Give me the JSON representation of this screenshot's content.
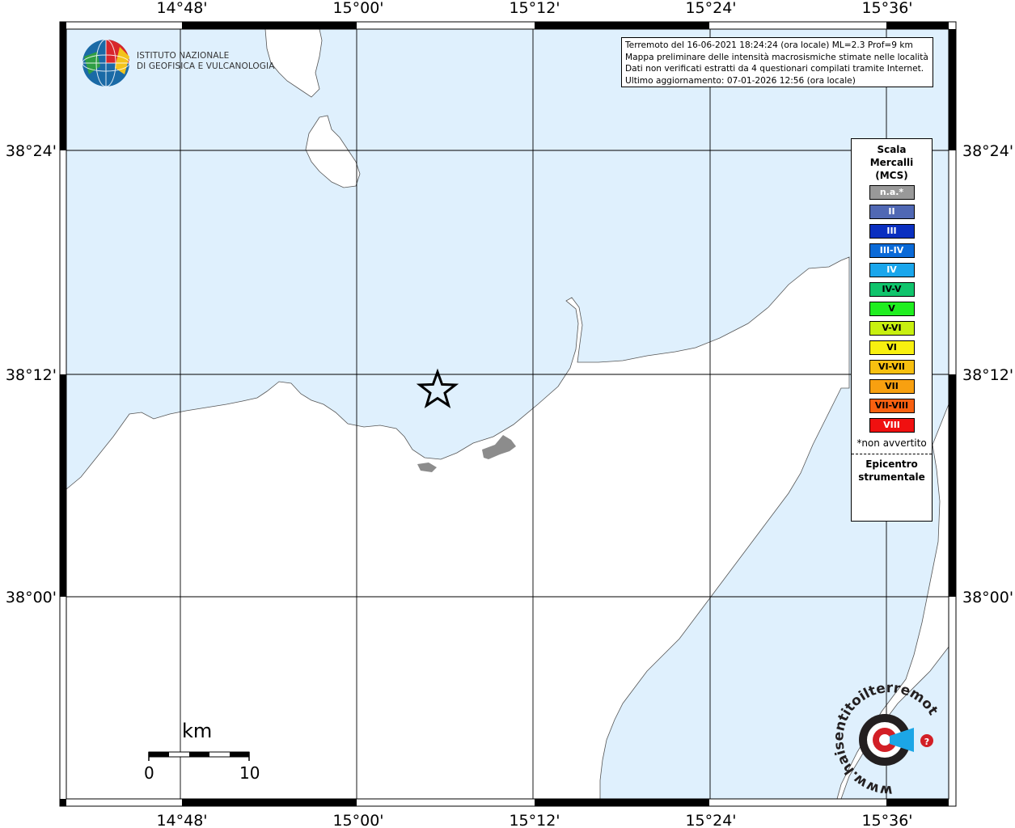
{
  "map": {
    "lon_ticks_top": [
      "14°48'",
      "15°00'",
      "15°12'",
      "15°24'",
      "15°36'"
    ],
    "lon_ticks_bottom": [
      "14°48'",
      "15°00'",
      "15°12'",
      "15°24'",
      "15°36'"
    ],
    "lat_ticks_left": [
      "38°24'",
      "38°12'",
      "38°00'"
    ],
    "lat_ticks_right": [
      "38°24'",
      "38°12'",
      "38°00'"
    ],
    "colors": {
      "sea": "#dff0fd",
      "land": "#ffffff",
      "town": "#8c8c8c"
    }
  },
  "info": {
    "line1": "Terremoto del 16-06-2021 18:24:24 (ora locale) ML=2.3 Prof=9 km",
    "line2": "Mappa preliminare delle intensità macrosismiche stimate nelle località",
    "line3": "Dati non verificati estratti da 4 questionari compilati tramite Internet.",
    "line4": "Ultimo aggiornamento: 07-01-2026 12:56 (ora locale)"
  },
  "logo": {
    "line1": "ISTITUTO NAZIONALE",
    "line2": "DI GEOFISICA E VULCANOLOGIA"
  },
  "legend": {
    "title1": "Scala",
    "title2": "Mercalli",
    "title3": "(MCS)",
    "classes": [
      {
        "label": "n.a.*",
        "color": "#999999"
      },
      {
        "label": "II",
        "color": "#5068b4"
      },
      {
        "label": "III",
        "color": "#0a2fc0"
      },
      {
        "label": "III-IV",
        "color": "#0a6ad8"
      },
      {
        "label": "IV",
        "color": "#1aa6ec"
      },
      {
        "label": "IV-V",
        "color": "#10c46c"
      },
      {
        "label": "V",
        "color": "#20ee20"
      },
      {
        "label": "V-VI",
        "color": "#c8f010"
      },
      {
        "label": "VI",
        "color": "#f8f010"
      },
      {
        "label": "VI-VII",
        "color": "#f8c010"
      },
      {
        "label": "VII",
        "color": "#f8a010"
      },
      {
        "label": "VII-VIII",
        "color": "#f86010"
      },
      {
        "label": "VIII",
        "color": "#f01010"
      }
    ],
    "note": "*non avvertito",
    "epicenter1": "Epicentro",
    "epicenter2": "strumentale"
  },
  "scale": {
    "unit": "km",
    "start": "0",
    "end": "10"
  },
  "watermark": {
    "text": "www.haisentitoilterremoto.it"
  }
}
